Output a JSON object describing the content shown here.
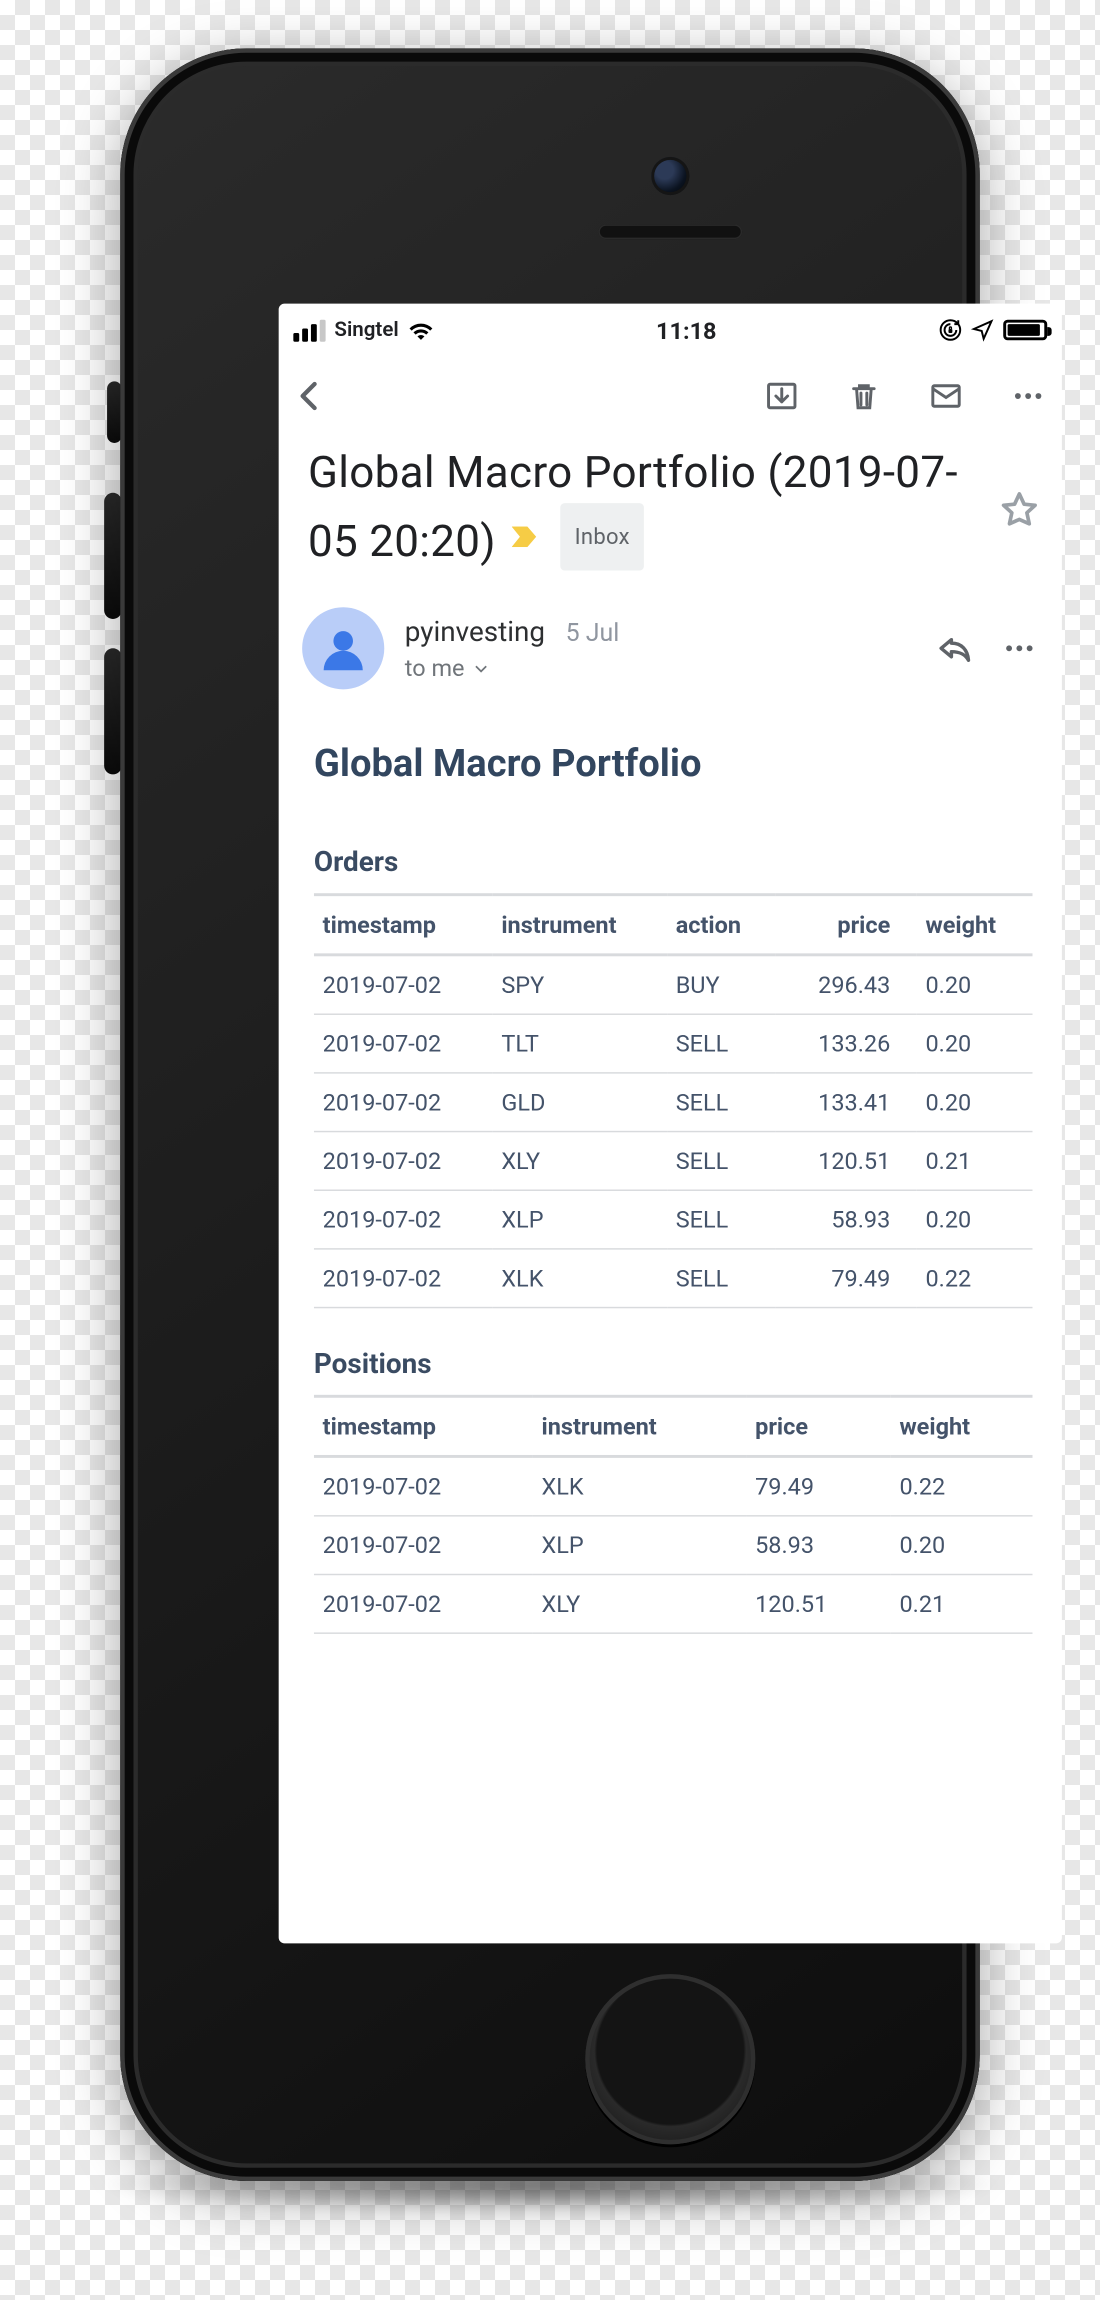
{
  "status": {
    "carrier": "Singtel",
    "time": "11:18"
  },
  "email": {
    "subject": "Global Macro Portfolio (2019-07-05 20:20)",
    "inbox_chip": "Inbox",
    "from": "pyinvesting",
    "date": "5 Jul",
    "to": "to me"
  },
  "body": {
    "title": "Global Macro Portfolio",
    "orders_title": "Orders",
    "positions_title": "Positions",
    "orders_columns": {
      "c0": "timestamp",
      "c1": "instrument",
      "c2": "action",
      "c3": "price",
      "c4": "weight"
    },
    "positions_columns": {
      "c0": "timestamp",
      "c1": "instrument",
      "c2": "price",
      "c3": "weight"
    },
    "orders": [
      {
        "timestamp": "2019-07-02",
        "instrument": "SPY",
        "action": "BUY",
        "price": "296.43",
        "weight": "0.20"
      },
      {
        "timestamp": "2019-07-02",
        "instrument": "TLT",
        "action": "SELL",
        "price": "133.26",
        "weight": "0.20"
      },
      {
        "timestamp": "2019-07-02",
        "instrument": "GLD",
        "action": "SELL",
        "price": "133.41",
        "weight": "0.20"
      },
      {
        "timestamp": "2019-07-02",
        "instrument": "XLY",
        "action": "SELL",
        "price": "120.51",
        "weight": "0.21"
      },
      {
        "timestamp": "2019-07-02",
        "instrument": "XLP",
        "action": "SELL",
        "price": "58.93",
        "weight": "0.20"
      },
      {
        "timestamp": "2019-07-02",
        "instrument": "XLK",
        "action": "SELL",
        "price": "79.49",
        "weight": "0.22"
      }
    ],
    "positions": [
      {
        "timestamp": "2019-07-02",
        "instrument": "XLK",
        "price": "79.49",
        "weight": "0.22"
      },
      {
        "timestamp": "2019-07-02",
        "instrument": "XLP",
        "price": "58.93",
        "weight": "0.20"
      },
      {
        "timestamp": "2019-07-02",
        "instrument": "XLY",
        "price": "120.51",
        "weight": "0.21"
      }
    ]
  }
}
